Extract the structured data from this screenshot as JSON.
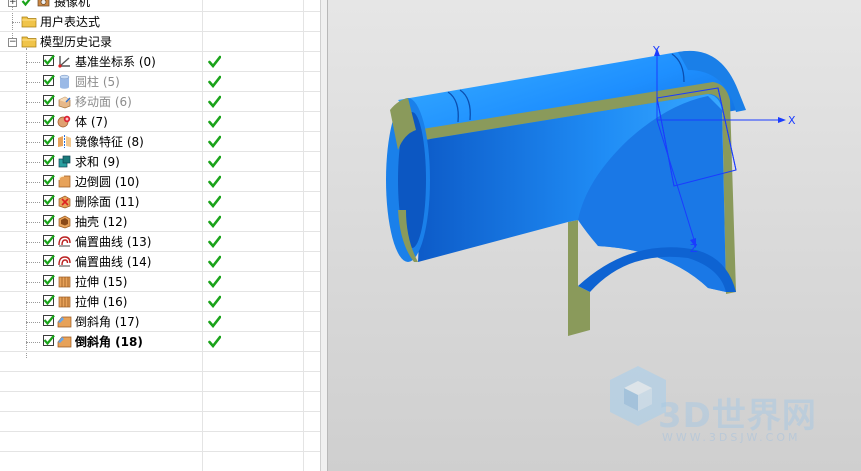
{
  "tree": {
    "rows": [
      {
        "id": "camera",
        "label": "摄像机",
        "dim": false,
        "bold": false,
        "checked": true,
        "status": ""
      },
      {
        "id": "user-expr",
        "label": "用户表达式",
        "dim": false,
        "bold": false,
        "checked": false,
        "status": ""
      },
      {
        "id": "history",
        "label": "模型历史记录",
        "dim": false,
        "bold": false,
        "checked": false,
        "status": ""
      },
      {
        "id": "feat-0",
        "label": "基准坐标系 (0)",
        "dim": false,
        "bold": false,
        "checked": true,
        "status": "ok",
        "icon": "datum-csys-icon"
      },
      {
        "id": "feat-5",
        "label": "圆柱 (5)",
        "dim": true,
        "bold": false,
        "checked": true,
        "status": "ok",
        "icon": "cylinder-icon"
      },
      {
        "id": "feat-6",
        "label": "移动面 (6)",
        "dim": true,
        "bold": false,
        "checked": true,
        "status": "ok",
        "icon": "move-face-icon"
      },
      {
        "id": "feat-7",
        "label": "体 (7)",
        "dim": false,
        "bold": false,
        "checked": true,
        "status": "ok",
        "icon": "body-icon"
      },
      {
        "id": "feat-8",
        "label": "镜像特征 (8)",
        "dim": false,
        "bold": false,
        "checked": true,
        "status": "ok",
        "icon": "mirror-feature-icon"
      },
      {
        "id": "feat-9",
        "label": "求和 (9)",
        "dim": false,
        "bold": false,
        "checked": true,
        "status": "ok",
        "icon": "unite-icon"
      },
      {
        "id": "feat-10",
        "label": "边倒圆 (10)",
        "dim": false,
        "bold": false,
        "checked": true,
        "status": "ok",
        "icon": "edge-blend-icon"
      },
      {
        "id": "feat-11",
        "label": "删除面 (11)",
        "dim": false,
        "bold": false,
        "checked": true,
        "status": "ok",
        "icon": "delete-face-icon"
      },
      {
        "id": "feat-12",
        "label": "抽壳 (12)",
        "dim": false,
        "bold": false,
        "checked": true,
        "status": "ok",
        "icon": "shell-icon"
      },
      {
        "id": "feat-13",
        "label": "偏置曲线 (13)",
        "dim": false,
        "bold": false,
        "checked": true,
        "status": "ok",
        "icon": "offset-curve-icon"
      },
      {
        "id": "feat-14",
        "label": "偏置曲线 (14)",
        "dim": false,
        "bold": false,
        "checked": true,
        "status": "ok",
        "icon": "offset-curve-icon"
      },
      {
        "id": "feat-15",
        "label": "拉伸 (15)",
        "dim": false,
        "bold": false,
        "checked": true,
        "status": "ok",
        "icon": "extrude-icon"
      },
      {
        "id": "feat-16",
        "label": "拉伸 (16)",
        "dim": false,
        "bold": false,
        "checked": true,
        "status": "ok",
        "icon": "extrude-icon"
      },
      {
        "id": "feat-17",
        "label": "倒斜角 (17)",
        "dim": false,
        "bold": false,
        "checked": true,
        "status": "ok",
        "icon": "chamfer-icon"
      },
      {
        "id": "feat-18",
        "label": "倒斜角 (18)",
        "dim": false,
        "bold": true,
        "checked": true,
        "status": "ok",
        "icon": "chamfer-icon"
      }
    ]
  },
  "viewport": {
    "axis_x_label": "X",
    "axis_y_label": "Y",
    "axis_z_label": "Z",
    "watermark_text": "3D世界网",
    "watermark_url": "WWW.3DSJW.COM"
  },
  "colors": {
    "part_blue": "#1e90ff",
    "part_edge": "#8a9a5b",
    "axis_blue": "#1a3cff",
    "check_green": "#1aa31a"
  }
}
